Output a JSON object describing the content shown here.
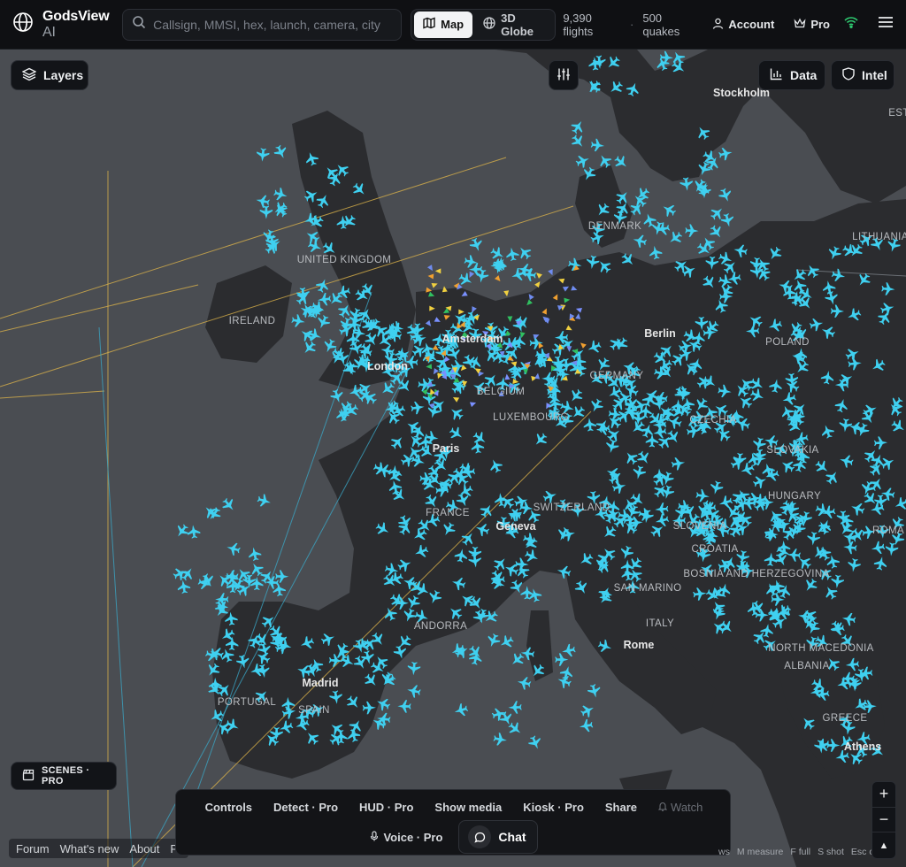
{
  "app": {
    "name": "GodsView",
    "name_suffix": "AI"
  },
  "search": {
    "placeholder": "Callsign, MMSI, hex, launch, camera, city"
  },
  "view_toggle": {
    "map_label": "Map",
    "globe_label": "3D Globe",
    "active": "Map"
  },
  "stats": {
    "flights": "9,390 flights",
    "separator": "·",
    "quakes": "500 quakes"
  },
  "account_label": "Account",
  "pro_label": "Pro",
  "controls": {
    "layers_label": "Layers",
    "data_label": "Data",
    "intel_label": "Intel",
    "scenes_label": "SCENES · PRO"
  },
  "dock": {
    "row1": [
      "Controls",
      "Detect · Pro",
      "HUD · Pro",
      "Show media",
      "Kiosk · Pro",
      "Share"
    ],
    "watch_label": "Watch",
    "voice_label": "Voice · Pro",
    "chat_label": "Chat"
  },
  "footer_links": [
    "Forum",
    "What's new",
    "About",
    "Pr"
  ],
  "keyboard_hints": [
    "ws",
    "M measure",
    "F full",
    "S shot",
    "Esc close"
  ],
  "map": {
    "labels": [
      {
        "text": "Stockholm",
        "type": "city"
      },
      {
        "text": "EST",
        "type": "country"
      },
      {
        "text": "DENMARK",
        "type": "country"
      },
      {
        "text": "LITHUANIA",
        "type": "country"
      },
      {
        "text": "UNITED KINGDOM",
        "type": "country"
      },
      {
        "text": "IRELAND",
        "type": "country"
      },
      {
        "text": "Amsterdam",
        "type": "city"
      },
      {
        "text": "Berlin",
        "type": "city"
      },
      {
        "text": "POLAND",
        "type": "country"
      },
      {
        "text": "London",
        "type": "city"
      },
      {
        "text": "GERMANY",
        "type": "country"
      },
      {
        "text": "BELGIUM",
        "type": "country"
      },
      {
        "text": "LUXEMBOURG",
        "type": "country"
      },
      {
        "text": "CZECHIA",
        "type": "country"
      },
      {
        "text": "Paris",
        "type": "city"
      },
      {
        "text": "SLOVAKIA",
        "type": "country"
      },
      {
        "text": "HUNGARY",
        "type": "country"
      },
      {
        "text": "FRANCE",
        "type": "country"
      },
      {
        "text": "SWITZERLAND",
        "type": "country"
      },
      {
        "text": "Geneva",
        "type": "city"
      },
      {
        "text": "SLOVENIA",
        "type": "country"
      },
      {
        "text": "ROMA",
        "type": "country"
      },
      {
        "text": "CROATIA",
        "type": "country"
      },
      {
        "text": "BOSNIA AND HERZEGOVINA",
        "type": "country"
      },
      {
        "text": "SAN MARINO",
        "type": "country"
      },
      {
        "text": "ANDORRA",
        "type": "country"
      },
      {
        "text": "ITALY",
        "type": "country"
      },
      {
        "text": "Rome",
        "type": "city"
      },
      {
        "text": "NORTH MACEDONIA",
        "type": "country"
      },
      {
        "text": "ALBANIA",
        "type": "country"
      },
      {
        "text": "Madrid",
        "type": "city"
      },
      {
        "text": "PORTUGAL",
        "type": "country"
      },
      {
        "text": "SPAIN",
        "type": "country"
      },
      {
        "text": "GREECE",
        "type": "country"
      },
      {
        "text": "Athens",
        "type": "city"
      }
    ]
  },
  "colors": {
    "aircraft": "#3fd0f0",
    "land": "#2b2c2f",
    "sea": "#4a4d52",
    "track_lines": "#e0b64a",
    "topbar": "#0f1013"
  }
}
